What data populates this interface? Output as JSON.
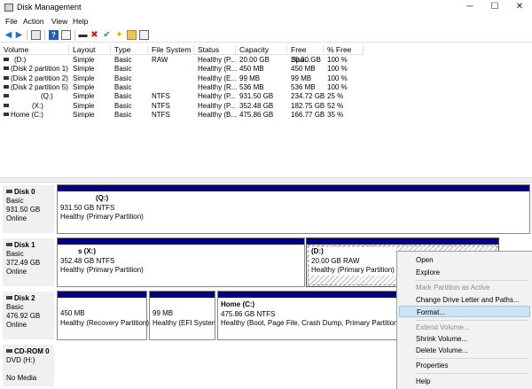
{
  "window": {
    "title": "Disk Management",
    "minimize": "─",
    "maximize": "☐",
    "close": "✕"
  },
  "menu": [
    "File",
    "Action",
    "View",
    "Help"
  ],
  "columns": [
    "Volume",
    "Layout",
    "Type",
    "File System",
    "Status",
    "Capacity",
    "Free Spa...",
    "% Free"
  ],
  "volumes": [
    [
      "(D:)",
      "Simple",
      "Basic",
      "RAW",
      "Healthy (P...",
      "20.00 GB",
      "20.00 GB",
      "100 %"
    ],
    [
      "(Disk 2 partition 1)",
      "Simple",
      "Basic",
      "",
      "Healthy (R...",
      "450 MB",
      "450 MB",
      "100 %"
    ],
    [
      "(Disk 2 partition 2)",
      "Simple",
      "Basic",
      "",
      "Healthy (E...",
      "99 MB",
      "99 MB",
      "100 %"
    ],
    [
      "(Disk 2 partition 5)",
      "Simple",
      "Basic",
      "",
      "Healthy (R...",
      "536 MB",
      "536 MB",
      "100 %"
    ],
    [
      "(Q:)",
      "Simple",
      "Basic",
      "NTFS",
      "Healthy (P...",
      "931.50 GB",
      "234.72 GB",
      "25 %"
    ],
    [
      "(X:)",
      "Simple",
      "Basic",
      "NTFS",
      "Healthy (P...",
      "352.48 GB",
      "182.75 GB",
      "52 %"
    ],
    [
      "Home (C:)",
      "Simple",
      "Basic",
      "NTFS",
      "Healthy (B...",
      "475.86 GB",
      "166.77 GB",
      "35 %"
    ]
  ],
  "disks": {
    "disk0": {
      "name": "Disk 0",
      "type": "Basic",
      "size": "931.50 GB",
      "status": "Online"
    },
    "disk1": {
      "name": "Disk 1",
      "type": "Basic",
      "size": "372.49 GB",
      "status": "Online"
    },
    "disk2": {
      "name": "Disk 2",
      "type": "Basic",
      "size": "476.92 GB",
      "status": "Online"
    },
    "cdrom0": {
      "name": "CD-ROM 0",
      "type": "DVD (H:)",
      "size": "",
      "status": "No Media"
    }
  },
  "partitions": {
    "q": {
      "title": "(Q:)",
      "size": "931.50 GB NTFS",
      "status": "Healthy (Primary Partition)"
    },
    "x": {
      "title": "s  (X:)",
      "size": "352.48 GB NTFS",
      "status": "Healthy (Primary Partition)"
    },
    "d": {
      "title": "(D:)",
      "size": "20.00 GB RAW",
      "status": "Healthy (Primary Partition)"
    },
    "rec": {
      "size": "450 MB",
      "status": "Healthy (Recovery Partition)"
    },
    "efi": {
      "size": "99 MB",
      "status": "Healthy (EFI System P"
    },
    "home": {
      "title": "Home  (C:)",
      "size": "475.86 GB NTFS",
      "status": "Healthy (Boot, Page File, Crash Dump, Primary Partition)"
    }
  },
  "context_menu": {
    "open": "Open",
    "explore": "Explore",
    "mark_active": "Mark Partition as Active",
    "change_letter": "Change Drive Letter and Paths...",
    "format": "Format...",
    "extend": "Extend Volume...",
    "shrink": "Shrink Volume...",
    "delete": "Delete Volume...",
    "properties": "Properties",
    "help": "Help"
  },
  "colors": {
    "primary_bar": "#000080",
    "highlight": "#cce4f7"
  }
}
